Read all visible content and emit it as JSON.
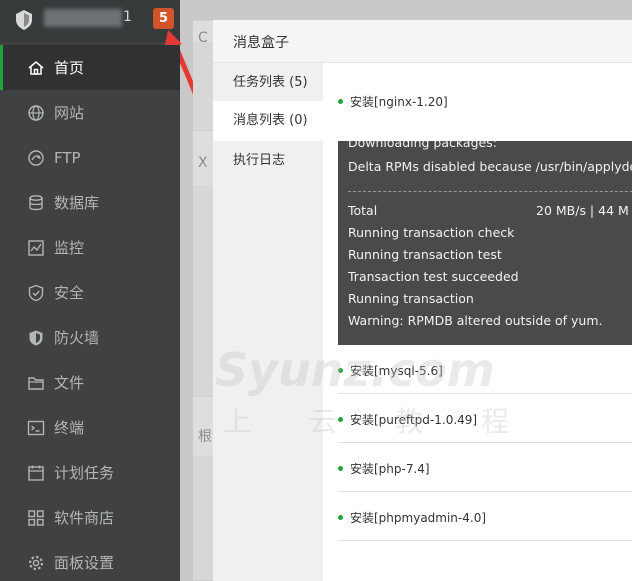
{
  "sidebar": {
    "ip_suffix": "1",
    "badge_count": "5",
    "items": [
      {
        "label": "首页",
        "icon": "home-icon",
        "active": true
      },
      {
        "label": "网站",
        "icon": "globe-icon",
        "active": false
      },
      {
        "label": "FTP",
        "icon": "ftp-icon",
        "active": false
      },
      {
        "label": "数据库",
        "icon": "database-icon",
        "active": false
      },
      {
        "label": "监控",
        "icon": "monitor-icon",
        "active": false
      },
      {
        "label": "安全",
        "icon": "shield-check-icon",
        "active": false
      },
      {
        "label": "防火墙",
        "icon": "firewall-shield-icon",
        "active": false
      },
      {
        "label": "文件",
        "icon": "folder-icon",
        "active": false
      },
      {
        "label": "终端",
        "icon": "terminal-icon",
        "active": false
      },
      {
        "label": "计划任务",
        "icon": "calendar-icon",
        "active": false
      },
      {
        "label": "软件商店",
        "icon": "apps-grid-icon",
        "active": false
      },
      {
        "label": "面板设置",
        "icon": "gear-icon",
        "active": false
      }
    ]
  },
  "background": {
    "frag_1": "C",
    "frag_2": "X",
    "frag_3": "根"
  },
  "dialog": {
    "title": "消息盒子",
    "tabs": [
      {
        "label": "任务列表 (5)",
        "active": false
      },
      {
        "label": "消息列表 (0)",
        "active": true
      },
      {
        "label": "执行日志",
        "active": false
      }
    ],
    "tasks": [
      {
        "label": "安装[nginx-1.20]"
      },
      {
        "label": "安装[mysql-5.6]"
      },
      {
        "label": "安装[pureftpd-1.0.49]"
      },
      {
        "label": "安装[php-7.4]"
      },
      {
        "label": "安装[phpmyadmin-4.0]"
      }
    ],
    "console": {
      "lines": [
        "Downloading packages:",
        "Delta RPMs disabled because /usr/bin/applydelta",
        "Total",
        "Running transaction check",
        "Running transaction test",
        "Transaction test succeeded",
        "Running transaction",
        "Warning: RPMDB altered outside of yum."
      ],
      "total_stats": "20 MB/s |  44 M"
    }
  },
  "watermark": {
    "text": "Syunz.com",
    "sub": "上云教程"
  },
  "colors": {
    "sidebar_bg": "#3f4142",
    "accent_green": "#20a53a",
    "badge": "#d2542b",
    "arrow": "#e53935"
  }
}
